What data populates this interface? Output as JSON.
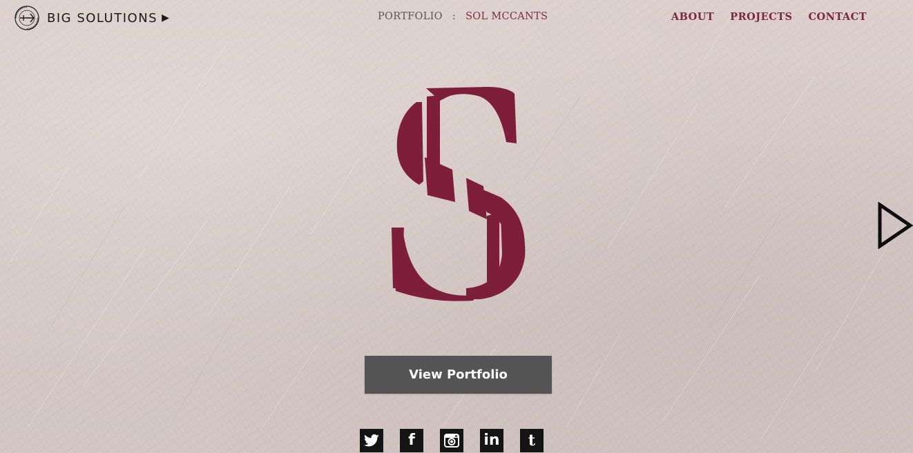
{
  "brand": {
    "badge_text": "DETERMINED · EXCELLENCE · PUMA35",
    "name": "BIG SOLUTIONS",
    "arrow": "▶"
  },
  "breadcrumb": {
    "section": "PORTFOLIO",
    "separator": ":",
    "name": "SOL MCCANTS"
  },
  "nav": {
    "items": [
      {
        "label": "ABOUT"
      },
      {
        "label": "PROJECTS"
      },
      {
        "label": "CONTACT"
      }
    ]
  },
  "hero": {
    "monogram_letter": "S",
    "monogram_color": "#7d1f3a"
  },
  "cta": {
    "label": "View Portfolio"
  },
  "social": {
    "items": [
      {
        "name": "twitter-icon"
      },
      {
        "name": "facebook-icon",
        "glyph": "f"
      },
      {
        "name": "instagram-icon"
      },
      {
        "name": "linkedin-icon",
        "glyph": "in"
      },
      {
        "name": "tumblr-icon",
        "glyph": "t"
      }
    ]
  },
  "colors": {
    "accent": "#7a2740",
    "button_bg": "#555455",
    "social_bg": "#141414"
  }
}
